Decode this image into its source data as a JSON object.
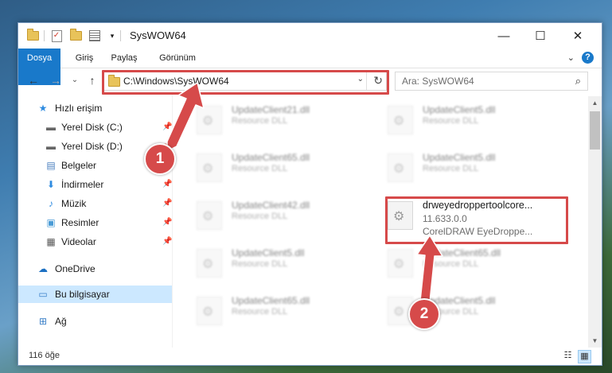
{
  "window": {
    "title": "SysWOW64",
    "qa_dropdown": "▾",
    "controls": {
      "minimize": "—",
      "maximize": "☐",
      "close": "✕"
    }
  },
  "ribbon": {
    "tabs": [
      "Dosya",
      "Giriş",
      "Paylaş",
      "Görünüm"
    ],
    "expand_glyph": "⌄",
    "help_glyph": "?"
  },
  "navigation": {
    "back": "←",
    "forward": "→",
    "recent": "⌄",
    "up": "↑"
  },
  "address": {
    "path": "C:\\Windows\\SysWOW64",
    "dropdown": "⌄",
    "refresh": "↻"
  },
  "search": {
    "placeholder": "Ara: SysWOW64",
    "icon": "search-icon"
  },
  "sidebar": {
    "items": [
      {
        "label": "Hızlı erişim",
        "icon": "star-icon",
        "glyph": "★",
        "color": "#2e8be0",
        "pinned": false
      },
      {
        "label": "Yerel Disk (C:)",
        "icon": "drive-icon",
        "glyph": "▬",
        "color": "#666666",
        "pinned": true
      },
      {
        "label": "Yerel Disk (D:)",
        "icon": "drive-icon",
        "glyph": "▬",
        "color": "#666666",
        "pinned": true
      },
      {
        "label": "Belgeler",
        "icon": "documents-icon",
        "glyph": "▤",
        "color": "#4a7fbf",
        "pinned": true
      },
      {
        "label": "İndirmeler",
        "icon": "download-icon",
        "glyph": "⬇",
        "color": "#2e8be0",
        "pinned": true
      },
      {
        "label": "Müzik",
        "icon": "music-icon",
        "glyph": "♪",
        "color": "#2e8be0",
        "pinned": true
      },
      {
        "label": "Resimler",
        "icon": "pictures-icon",
        "glyph": "▣",
        "color": "#4a9bd6",
        "pinned": true
      },
      {
        "label": "Videolar",
        "icon": "video-icon",
        "glyph": "▦",
        "color": "#555555",
        "pinned": true
      },
      {
        "label": "OneDrive",
        "icon": "cloud-icon",
        "glyph": "☁",
        "color": "#1b6fc2",
        "pinned": false
      },
      {
        "label": "Bu bilgisayar",
        "icon": "computer-icon",
        "glyph": "▭",
        "color": "#3a7fc8",
        "pinned": false,
        "selected": true
      },
      {
        "label": "Ağ",
        "icon": "network-icon",
        "glyph": "⊞",
        "color": "#3a7fc8",
        "pinned": false
      }
    ],
    "pin_glyph": "📌"
  },
  "files": [
    {
      "name": "UpdateClient21.dll",
      "desc": "Resource DLL",
      "blurred": true
    },
    {
      "name": "UpdateClient5.dll",
      "desc": "Resource DLL",
      "blurred": true
    },
    {
      "name": "UpdateClient65.dll",
      "desc": "Resource DLL",
      "blurred": true
    },
    {
      "name": "UpdateClient5.dll",
      "desc": "Resource DLL",
      "blurred": true
    },
    {
      "name": "UpdateClient42.dll",
      "desc": "Resource DLL",
      "blurred": true
    },
    {
      "name": "drweyedroppertoolcore...",
      "desc": "11.633.0.0",
      "desc2": "CorelDRAW EyeDroppe...",
      "blurred": false,
      "highlighted": true
    },
    {
      "name": "UpdateClient5.dll",
      "desc": "Resource DLL",
      "blurred": true
    },
    {
      "name": "UpdateClient65.dll",
      "desc": "Resource DLL",
      "blurred": true
    },
    {
      "name": "UpdateClient65.dll",
      "desc": "Resource DLL",
      "blurred": true
    },
    {
      "name": "UpdateClient5.dll",
      "desc": "Resource DLL",
      "blurred": true
    }
  ],
  "status": {
    "count": "116 öğe"
  },
  "callouts": [
    {
      "number": "1",
      "color": "#d64a4a"
    },
    {
      "number": "2",
      "color": "#d64a4a"
    }
  ]
}
